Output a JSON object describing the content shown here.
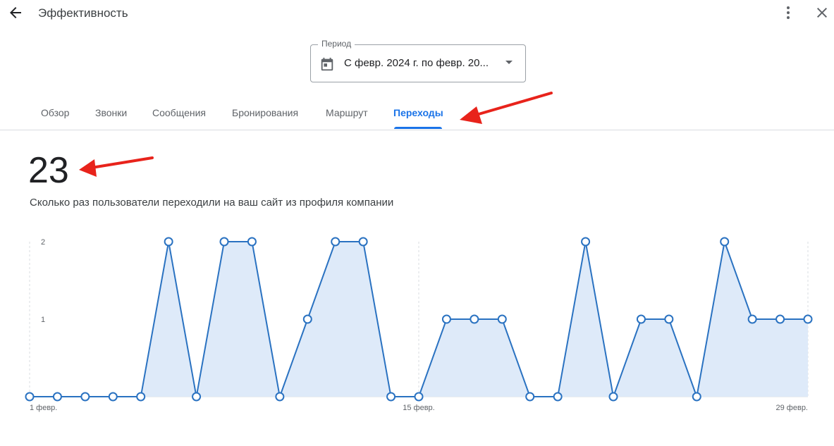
{
  "header": {
    "title": "Эффективность"
  },
  "period": {
    "label": "Период",
    "value": "С февр. 2024 г. по февр. 20..."
  },
  "tabs": [
    {
      "label": "Обзор"
    },
    {
      "label": "Звонки"
    },
    {
      "label": "Сообщения"
    },
    {
      "label": "Бронирования"
    },
    {
      "label": "Маршрут"
    },
    {
      "label": "Переходы",
      "active": true
    }
  ],
  "summary": {
    "total": "23",
    "description": "Сколько раз пользователи переходили на ваш сайт из профиля компании"
  },
  "colors": {
    "accent": "#1a73e8",
    "line": "#2a72c1",
    "area": "#deeaf9",
    "annotation": "#e8231b"
  },
  "icons": [
    "back-arrow-icon",
    "more-vert-icon",
    "close-icon",
    "calendar-icon",
    "dropdown-caret-icon"
  ],
  "chart_data": {
    "type": "area",
    "x": [
      1,
      2,
      3,
      4,
      5,
      6,
      7,
      8,
      9,
      10,
      11,
      12,
      13,
      14,
      15,
      16,
      17,
      18,
      19,
      20,
      21,
      22,
      23,
      24,
      25,
      26,
      27,
      28,
      29
    ],
    "values": [
      0,
      0,
      0,
      0,
      0,
      2,
      0,
      2,
      2,
      0,
      1,
      2,
      2,
      0,
      0,
      1,
      1,
      1,
      0,
      0,
      2,
      0,
      1,
      1,
      0,
      2,
      1,
      1,
      1
    ],
    "ylim": [
      0,
      2
    ],
    "yticks": [
      "1",
      "2"
    ],
    "xtick_labels": [
      {
        "day": 1,
        "label": "1 февр."
      },
      {
        "day": 15,
        "label": "15 февр."
      },
      {
        "day": 29,
        "label": "29 февр."
      }
    ],
    "grid": "vertical-dashed"
  }
}
